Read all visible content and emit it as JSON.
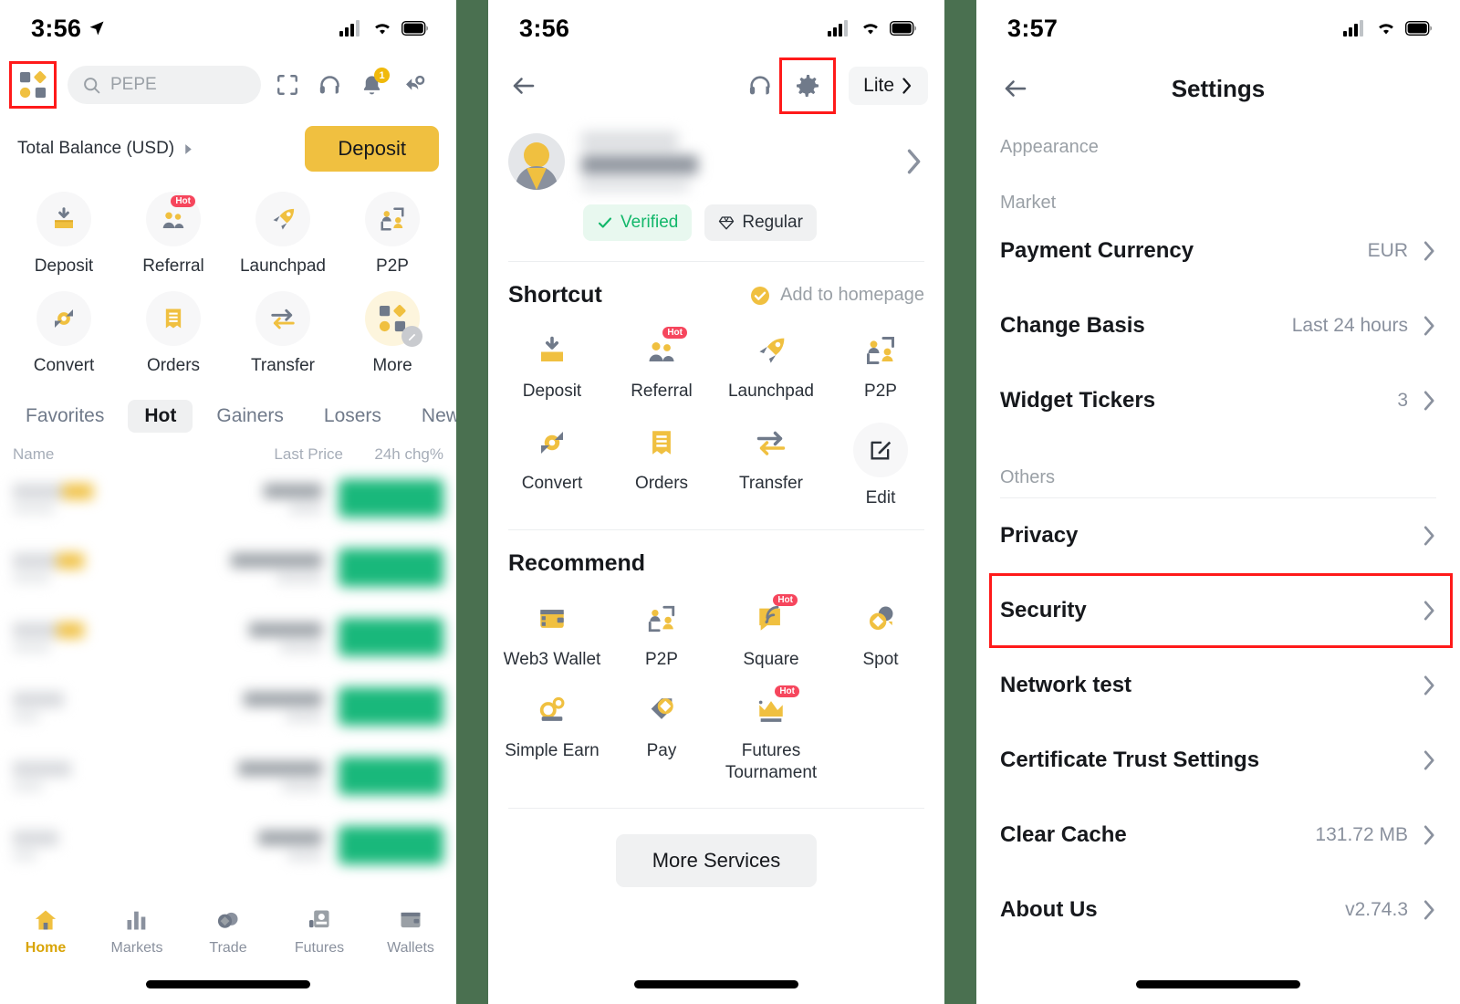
{
  "panel_home": {
    "status_bar": {
      "time": "3:56",
      "location_icon": "location-arrow-icon",
      "signal_icon": "cellular-signal-icon",
      "wifi_icon": "wifi-icon",
      "battery_icon": "battery-icon"
    },
    "header": {
      "grid_icon": "app-grid-icon",
      "search_placeholder": "PEPE",
      "search_icon": "search-icon",
      "scan_icon": "scan-qr-icon",
      "support_icon": "headset-support-icon",
      "notification_icon": "bell-notification-icon",
      "notification_count": "1",
      "share_icon": "share-invite-icon"
    },
    "balance": {
      "label": "Total Balance (USD)",
      "toggle_icon": "caret-right-icon",
      "deposit_button": "Deposit"
    },
    "quick_actions": [
      {
        "label": "Deposit",
        "icon": "deposit-arrow-icon",
        "badge": ""
      },
      {
        "label": "Referral",
        "icon": "referral-people-icon",
        "badge": "Hot"
      },
      {
        "label": "Launchpad",
        "icon": "rocket-icon",
        "badge": ""
      },
      {
        "label": "P2P",
        "icon": "p2p-people-icon",
        "badge": ""
      },
      {
        "label": "Convert",
        "icon": "convert-swap-icon",
        "badge": ""
      },
      {
        "label": "Orders",
        "icon": "orders-receipt-icon",
        "badge": ""
      },
      {
        "label": "Transfer",
        "icon": "transfer-arrows-icon",
        "badge": ""
      },
      {
        "label": "More",
        "icon": "more-grid-icon",
        "badge": ""
      }
    ],
    "market_tabs": [
      {
        "label": "Favorites",
        "active": false
      },
      {
        "label": "Hot",
        "active": true
      },
      {
        "label": "Gainers",
        "active": false
      },
      {
        "label": "Losers",
        "active": false
      },
      {
        "label": "New L",
        "active": false
      }
    ],
    "market_columns": {
      "name": "Name",
      "last_price": "Last Price",
      "change": "24h chg%"
    },
    "market_rows_count": 6,
    "bottom_nav": [
      {
        "label": "Home",
        "icon": "home-icon",
        "active": true
      },
      {
        "label": "Markets",
        "icon": "markets-bars-icon",
        "active": false
      },
      {
        "label": "Trade",
        "icon": "trade-coins-icon",
        "active": false
      },
      {
        "label": "Futures",
        "icon": "futures-icon",
        "active": false
      },
      {
        "label": "Wallets",
        "icon": "wallet-icon",
        "active": false
      }
    ]
  },
  "panel_profile": {
    "status_bar": {
      "time": "3:56"
    },
    "header": {
      "back_icon": "back-arrow-icon",
      "support_icon": "headset-support-icon",
      "settings_icon": "gear-settings-icon",
      "lite_label": "Lite",
      "lite_chevron": "chevron-right-icon"
    },
    "profile": {
      "avatar_icon": "user-avatar-icon",
      "verified_label": "Verified",
      "verified_icon": "check-icon",
      "regular_label": "Regular",
      "regular_icon": "diamond-vip-icon",
      "chevron": "chevron-right-icon"
    },
    "shortcut": {
      "title": "Shortcut",
      "add_to_homepage": "Add to homepage",
      "add_icon": "check-circle-icon",
      "items": [
        {
          "label": "Deposit",
          "icon": "deposit-arrow-icon",
          "badge": ""
        },
        {
          "label": "Referral",
          "icon": "referral-people-icon",
          "badge": "Hot"
        },
        {
          "label": "Launchpad",
          "icon": "rocket-icon",
          "badge": ""
        },
        {
          "label": "P2P",
          "icon": "p2p-people-icon",
          "badge": ""
        },
        {
          "label": "Convert",
          "icon": "convert-swap-icon",
          "badge": ""
        },
        {
          "label": "Orders",
          "icon": "orders-receipt-icon",
          "badge": ""
        },
        {
          "label": "Transfer",
          "icon": "transfer-arrows-icon",
          "badge": ""
        },
        {
          "label": "Edit",
          "icon": "edit-pencil-icon",
          "badge": ""
        }
      ]
    },
    "recommend": {
      "title": "Recommend",
      "items": [
        {
          "label": "Web3 Wallet",
          "icon": "web3-wallet-icon",
          "badge": ""
        },
        {
          "label": "P2P",
          "icon": "p2p-people-icon",
          "badge": ""
        },
        {
          "label": "Square",
          "icon": "square-feed-icon",
          "badge": "Hot"
        },
        {
          "label": "Spot",
          "icon": "spot-trade-icon",
          "badge": ""
        },
        {
          "label": "Simple Earn",
          "icon": "simple-earn-icon",
          "badge": ""
        },
        {
          "label": "Pay",
          "icon": "pay-tag-icon",
          "badge": ""
        },
        {
          "label": "Futures Tournament",
          "icon": "futures-crown-icon",
          "badge": "Hot"
        }
      ]
    },
    "more_services_button": "More Services"
  },
  "panel_settings": {
    "status_bar": {
      "time": "3:57"
    },
    "header": {
      "back_icon": "back-arrow-icon",
      "title": "Settings"
    },
    "groups": [
      {
        "label": "Appearance",
        "rows": []
      },
      {
        "label": "Market",
        "rows": [
          {
            "label": "Payment Currency",
            "value": "EUR",
            "highlighted": false
          },
          {
            "label": "Change Basis",
            "value": "Last 24 hours",
            "highlighted": false
          },
          {
            "label": "Widget Tickers",
            "value": "3",
            "highlighted": false
          }
        ]
      },
      {
        "label": "Others",
        "rows": [
          {
            "label": "Privacy",
            "value": "",
            "highlighted": false
          },
          {
            "label": "Security",
            "value": "",
            "highlighted": true
          },
          {
            "label": "Network test",
            "value": "",
            "highlighted": false
          },
          {
            "label": "Certificate Trust Settings",
            "value": "",
            "highlighted": false
          },
          {
            "label": "Clear Cache",
            "value": "131.72 MB",
            "highlighted": false
          },
          {
            "label": "About Us",
            "value": "v2.74.3",
            "highlighted": false
          }
        ]
      }
    ]
  },
  "colors": {
    "brand_yellow": "#f0b90b",
    "deposit_yellow": "#f0c040",
    "highlight_red": "#ff1a1a",
    "green_gain": "#19b87b",
    "verified_green": "#12b76a",
    "hot_red": "#f6465d",
    "separator_green": "#4a7050",
    "text_primary": "#16181c",
    "text_secondary": "#707a8a",
    "text_muted": "#9aa0a6"
  }
}
